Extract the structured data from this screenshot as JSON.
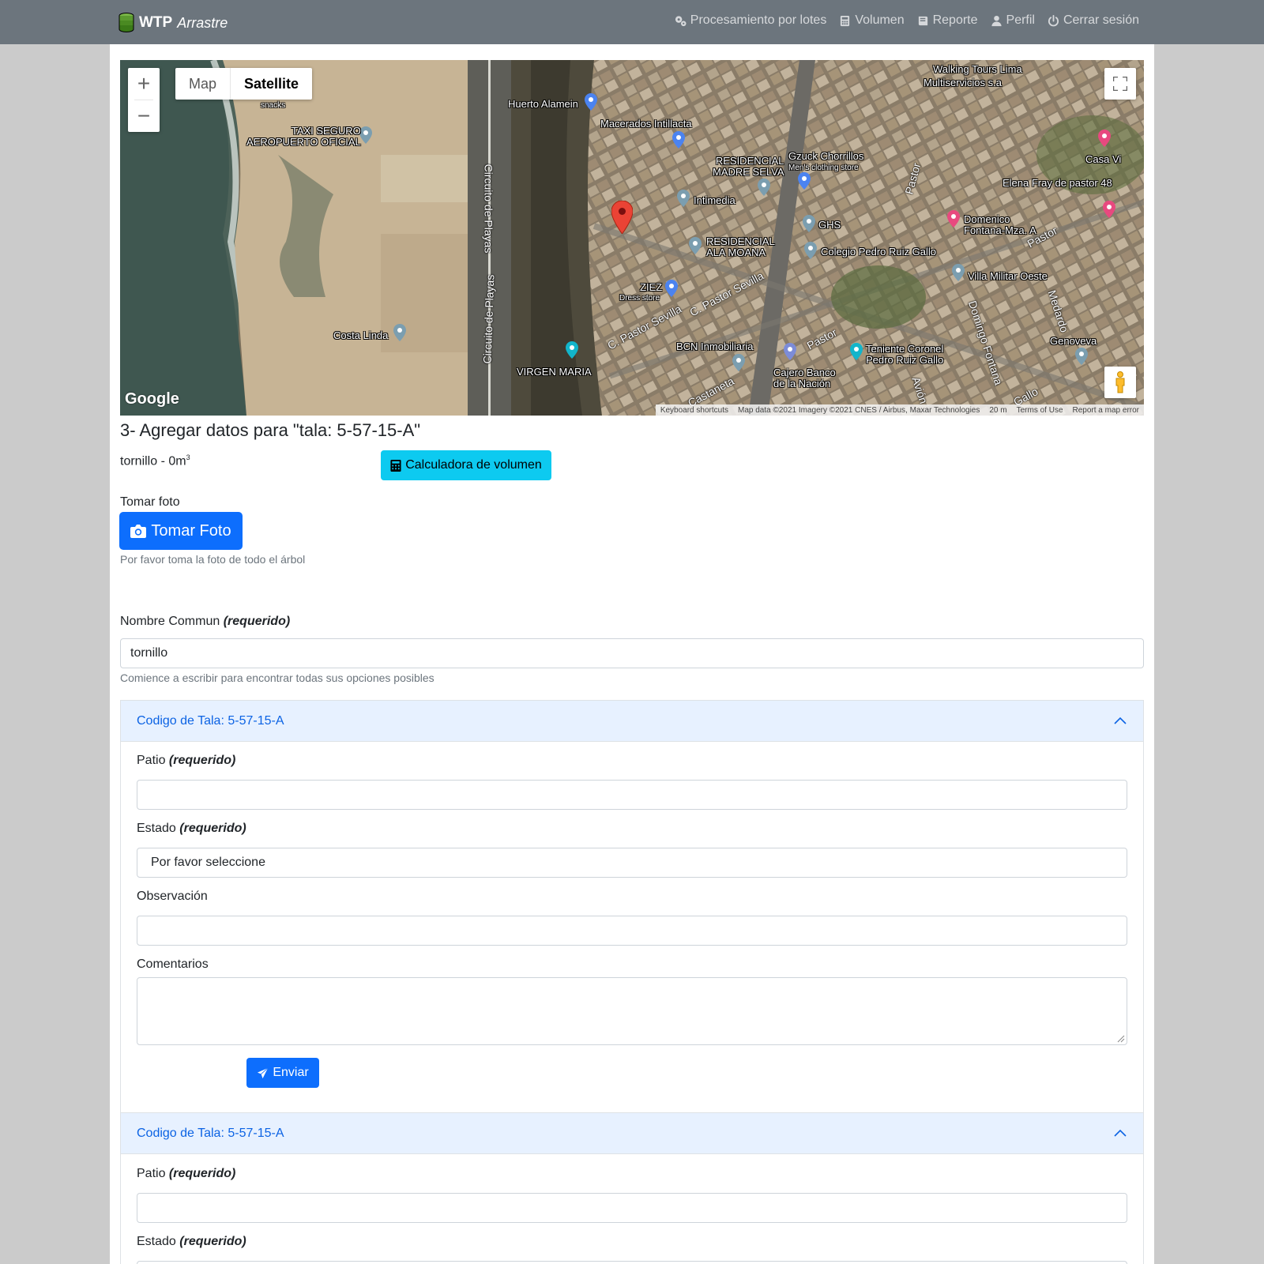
{
  "navbar": {
    "brand_bold": "WTP",
    "brand_italic": "Arrastre",
    "items": [
      {
        "label": "Procesamiento por lotes",
        "icon": "gears-icon"
      },
      {
        "label": "Volumen",
        "icon": "calculator-icon"
      },
      {
        "label": "Reporte",
        "icon": "book-icon"
      },
      {
        "label": "Perfil",
        "icon": "user-icon"
      },
      {
        "label": "Cerrar sesión",
        "icon": "power-icon"
      }
    ]
  },
  "map": {
    "type_map": "Map",
    "type_satellite": "Satellite",
    "selected_type": "Satellite",
    "google": "Google",
    "attribution": {
      "shortcuts": "Keyboard shortcuts",
      "data": "Map data ©2021 Imagery ©2021 CNES / Airbus, Maxar Technologies",
      "scale": "20 m",
      "terms": "Terms of Use",
      "report": "Report a map error"
    },
    "labels": {
      "taxi": "TAXI SEGURO\nAEROPUERTO OFICIAL",
      "snacks": "snacks",
      "huerto": "Huerto Alamein",
      "macerados": "Macerados Intillacta",
      "residencial_madre": "RESIDENCIAL\nMADRE SELVA",
      "gzuck": "Gzuck Chorrillos",
      "gzuck_sub": "Men's clothing store",
      "multiservicios": "Multiservicios s.a",
      "walking": "Walking Tours Lima",
      "casa": "Casa Vi",
      "elena": "Elena Fray de pastor 48",
      "intimedia": "Intimedia",
      "ghs": "GHS",
      "domenico": "Domenico\nFontana-Mza. A",
      "residencial_ala": "RESIDENCIAL\nALA MOANA",
      "colegio": "Colegio Pedro Ruiz Gallo",
      "villa": "Villa Militar Oeste",
      "ziez": "ZIEZ",
      "ziez_sub": "Dress store",
      "costa": "Costa Linda",
      "bcn": "BCN Inmobiliaria",
      "teniente": "Teniente Coronel\nPedro Ruiz Gallo",
      "genoveva": "Genoveva",
      "virgen": "VIRGEN MARIA",
      "cajero": "Cajero Banco\nde la Nación",
      "circuito1": "Circuito de Playas",
      "circuito2": "Circuito de Playas",
      "pastor_sevilla1": "C. Pastor Sevilla",
      "pastor_sevilla2": "C. Pastor Sevilla",
      "pastor1": "Pastor",
      "pastor2": "Pastor",
      "pastor3": "Pastor",
      "domingo": "Domingo Fontana",
      "medardo": "Medardo",
      "castaneta": "Castaneta",
      "avion": "Avión",
      "gallo": "Gallo"
    }
  },
  "form": {
    "title": "3- Agregar datos para \"tala: 5-57-15-A\"",
    "volume_text": "tornillo - 0m",
    "volume_sup": "3",
    "calc_button": "Calculadora de volumen",
    "photo_label": "Tomar foto",
    "photo_button": "Tomar Foto",
    "photo_help": "Por favor toma la foto de todo el árbol",
    "nombre_label": "Nombre Commun",
    "required": "(requerido)",
    "nombre_value": "tornillo",
    "nombre_help": "Comience a escribir para encontrar todas sus opciones posibles"
  },
  "accordions": [
    {
      "header": "Codigo de Tala: 5-57-15-A",
      "patio_label": "Patio",
      "estado_label": "Estado",
      "estado_value": "Por favor seleccione",
      "observacion_label": "Observación",
      "comentarios_label": "Comentarios",
      "send_button": "Enviar"
    },
    {
      "header": "Codigo de Tala: 5-57-15-A",
      "patio_label": "Patio",
      "estado_label": "Estado"
    }
  ]
}
